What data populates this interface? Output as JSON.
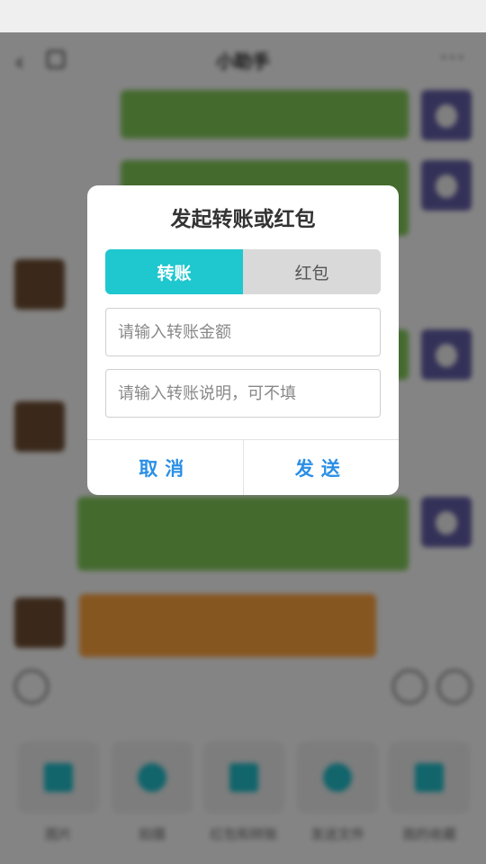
{
  "background": {
    "chat_title": "小助手",
    "tray_items": [
      "图片",
      "拍摄",
      "红包和转账",
      "发送文件",
      "我的收藏"
    ]
  },
  "dialog": {
    "title": "发起转账或红包",
    "tabs": [
      {
        "label": "转账",
        "active": true
      },
      {
        "label": "红包",
        "active": false
      }
    ],
    "amount_placeholder": "请输入转账金额",
    "amount_value": "",
    "note_placeholder": "请输入转账说明，可不填",
    "note_value": "",
    "cancel_label": "取消",
    "send_label": "发送"
  },
  "colors": {
    "accent": "#1fc7cf",
    "action_text": "#2a8fe6"
  }
}
